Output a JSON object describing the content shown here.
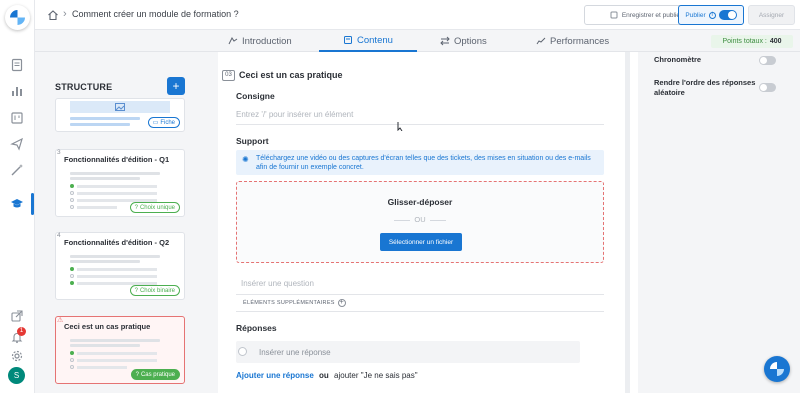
{
  "breadcrumb": {
    "title": "Comment créer un module de formation ?"
  },
  "toolbar": {
    "save_label": "Enregistrer et publier",
    "publish_label": "Publier",
    "assign_label": "Assigner"
  },
  "tabs": [
    {
      "label": "Introduction",
      "icon": "intro-icon"
    },
    {
      "label": "Contenu",
      "icon": "content-icon"
    },
    {
      "label": "Options",
      "icon": "options-icon"
    },
    {
      "label": "Performances",
      "icon": "chart-icon"
    }
  ],
  "points": {
    "label": "Points totaux :",
    "value": "400"
  },
  "structure": {
    "title": "STRUCTURE",
    "add_label": "+",
    "cards": [
      {
        "num": "",
        "title": "",
        "tag": "Fiche"
      },
      {
        "num": "3",
        "title": "Fonctionnalités d'édition - Q1",
        "tag": "Choix unique"
      },
      {
        "num": "4",
        "title": "Fonctionnalités d'édition - Q2",
        "tag": "Choix binaire"
      },
      {
        "num": "",
        "title": "Ceci est un cas pratique",
        "tag": "Cas pratique"
      }
    ]
  },
  "section": {
    "num": "03",
    "title": "Ceci est un cas pratique",
    "consigne_label": "Consigne",
    "consigne_placeholder": "Entrez '/' pour insérer un élément",
    "support_label": "Support",
    "support_info": "Téléchargez une vidéo ou des captures d'écran telles que des tickets, des mises en situation ou des e-mails afin de fournir un exemple concret.",
    "drop_title": "Glisser-déposer",
    "drop_or": "OU",
    "drop_button": "Sélectionner un fichier",
    "question_placeholder": "Insérer une question",
    "extras_label": "ÉLÉMENTS SUPPLÉMENTAIRES",
    "answers_label": "Réponses",
    "answer_placeholder": "Insérer une réponse",
    "add_answer_link": "Ajouter une réponse",
    "add_answer_or": "ou",
    "add_unknown": "ajouter \"Je ne sais pas\""
  },
  "settings": {
    "chrono_label": "Chronomètre",
    "random_label": "Rendre l'ordre des réponses aléatoire"
  },
  "user": {
    "initial": "S"
  },
  "notifications": {
    "count": "1"
  }
}
